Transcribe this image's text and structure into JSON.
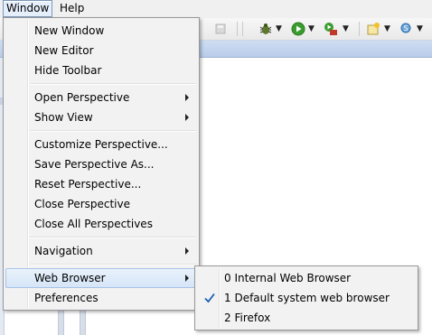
{
  "menubar": {
    "items": [
      {
        "label": "Window",
        "open": true
      },
      {
        "label": "Help",
        "open": false
      }
    ]
  },
  "toolbar": {
    "icons": [
      "save-icon",
      "debug-icon",
      "run-icon",
      "external-tools-icon",
      "new-wizard-icon",
      "search-icon"
    ]
  },
  "window_menu": {
    "items": [
      {
        "label": "New Window"
      },
      {
        "label": "New Editor"
      },
      {
        "label": "Hide Toolbar"
      },
      {
        "label": "Open Perspective",
        "submenu": true
      },
      {
        "label": "Show View",
        "submenu": true
      },
      {
        "label": "Customize Perspective..."
      },
      {
        "label": "Save Perspective As..."
      },
      {
        "label": "Reset Perspective..."
      },
      {
        "label": "Close Perspective"
      },
      {
        "label": "Close All Perspectives"
      },
      {
        "label": "Navigation",
        "submenu": true
      },
      {
        "label": "Web Browser",
        "submenu": true,
        "highlighted": true
      },
      {
        "label": "Preferences"
      }
    ]
  },
  "web_browser_submenu": {
    "items": [
      {
        "label": "0 Internal Web Browser",
        "checked": false
      },
      {
        "label": "1 Default system web browser",
        "checked": true
      },
      {
        "label": "2 Firefox",
        "checked": false
      }
    ]
  },
  "colors": {
    "highlight": "#d6e5f8",
    "highlight_border": "#a9c3e4",
    "menu_bg": "#f2f2f2",
    "check": "#1a5fb4"
  }
}
